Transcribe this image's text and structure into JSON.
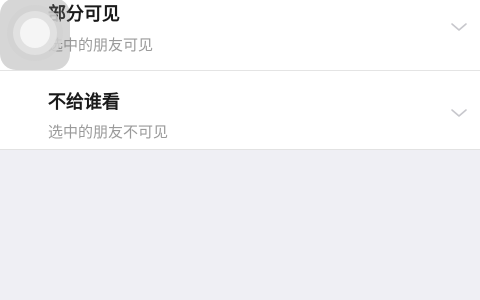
{
  "visibility_options": [
    {
      "title": "部分可见",
      "subtitle": "选中的朋友可见"
    },
    {
      "title": "不给谁看",
      "subtitle": "选中的朋友不可见"
    }
  ],
  "icons": {
    "chevron": "chevron-down-icon",
    "floating": "assistive-touch-icon"
  },
  "colors": {
    "background": "#efeff4",
    "card": "#ffffff",
    "title": "#1a1a1a",
    "subtitle": "#9a9a9a",
    "chevron": "#c7c7cc"
  }
}
